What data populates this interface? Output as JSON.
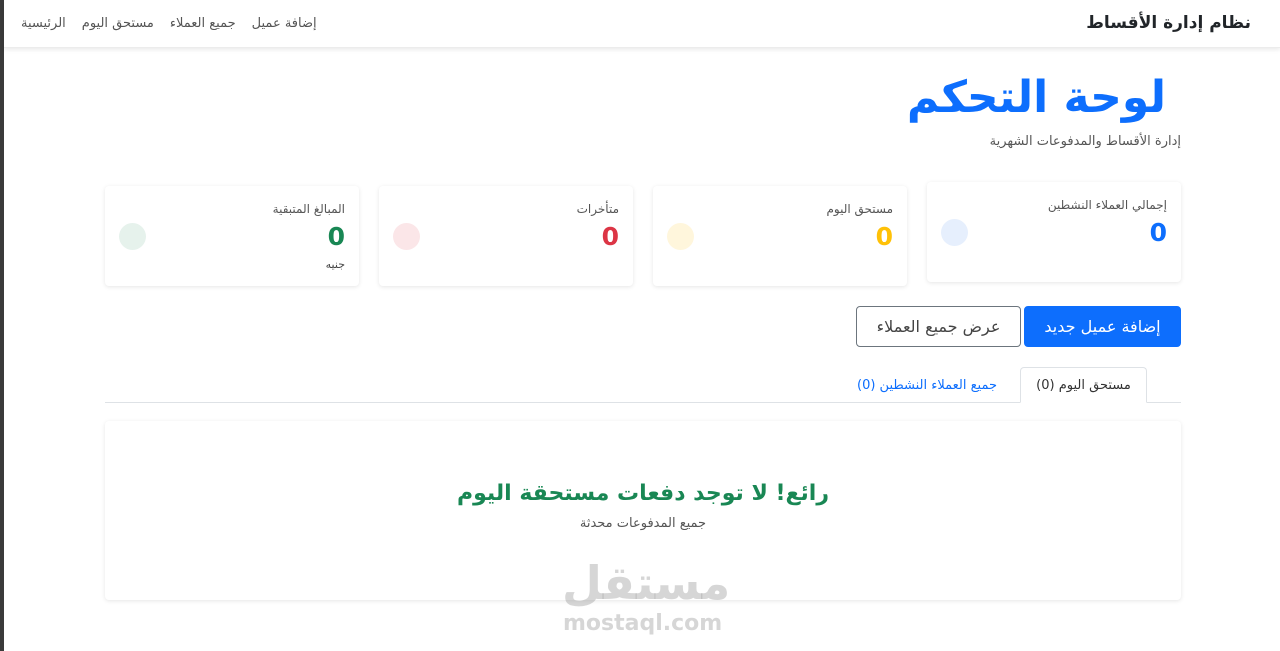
{
  "navbar": {
    "brand": "نظام إدارة الأقساط",
    "links": [
      "الرئيسية",
      "مستحق اليوم",
      "جميع العملاء",
      "إضافة عميل"
    ]
  },
  "header": {
    "title": "لوحة التحكم",
    "subtitle": "إدارة الأقساط والمدفوعات الشهرية"
  },
  "stats": [
    {
      "label": "إجمالي العملاء النشطين",
      "value": "0",
      "unit": "",
      "color": "#0d6efd",
      "dot_color": "#e6effd"
    },
    {
      "label": "مستحق اليوم",
      "value": "0",
      "unit": "",
      "color": "#ffc107",
      "dot_color": "#fff6dc"
    },
    {
      "label": "متأخرات",
      "value": "0",
      "unit": "",
      "color": "#dc3545",
      "dot_color": "#fbe6e8"
    },
    {
      "label": "المبالغ المتبقية",
      "value": "0",
      "unit": "جنيه",
      "color": "#198754",
      "dot_color": "#e6f2ec"
    }
  ],
  "actions": {
    "add_client": "إضافة عميل جديد",
    "view_all": "عرض جميع العملاء"
  },
  "tabs": [
    {
      "label": "مستحق اليوم (0)",
      "active": true
    },
    {
      "label": "جميع العملاء النشطين (0)",
      "active": false
    }
  ],
  "empty_state": {
    "title": "رائع! لا توجد دفعات مستحقة اليوم",
    "subtitle": "جميع المدفوعات محدثة"
  },
  "watermark": {
    "arabic": "مستقل",
    "latin": "mostaql.com"
  }
}
